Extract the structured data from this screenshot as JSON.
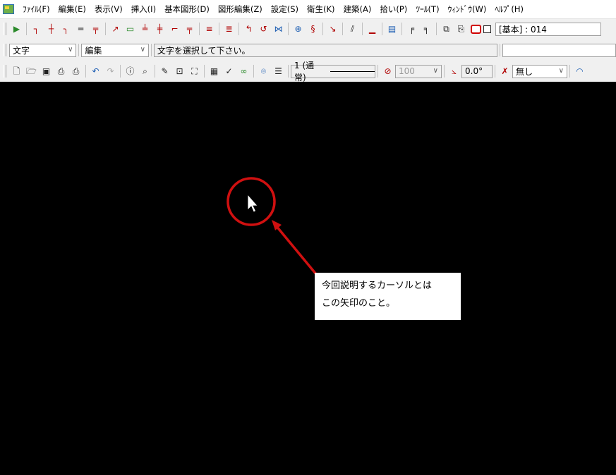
{
  "menubar": {
    "items": [
      "ﾌｧｲﾙ(F)",
      "編集(E)",
      "表示(V)",
      "挿入(I)",
      "基本図形(D)",
      "図形編集(Z)",
      "設定(S)",
      "衛生(K)",
      "建築(A)",
      "拾い(P)",
      "ﾂｰﾙ(T)",
      "ｳｨﾝﾄﾞｳ(W)",
      "ﾍﾙﾌﾟ(H)"
    ]
  },
  "toolbar1": {
    "layer_label": "[基本] : 014"
  },
  "toolbar2": {
    "object_type": "文字",
    "mode": "編集",
    "status_message": "文字を選択して下さい。",
    "right_field": ""
  },
  "toolbar3": {
    "line_type": "1 (通常)",
    "scale_value": "100",
    "angle_value": "0.0°",
    "fill_option": "無し"
  },
  "annotation": {
    "callout_line1": "今回説明するカーソルとは",
    "callout_line2": "この矢印のこと。"
  },
  "colors": {
    "canvas_bg": "#000000",
    "highlight": "#d01010",
    "cursor": "#ffffff"
  }
}
